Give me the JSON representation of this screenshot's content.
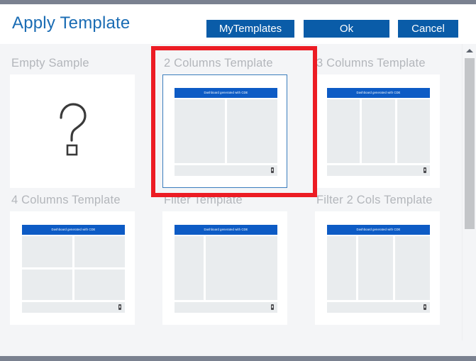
{
  "window": {
    "chrome_color": "#7a8190",
    "background": "#f4f5f7"
  },
  "header": {
    "title": "Apply Template",
    "title_color": "#1a6cb4",
    "button_color": "#0a5ca8",
    "buttons": [
      {
        "id": "mytemplates",
        "label": "MyTemplates"
      },
      {
        "id": "ok",
        "label": "Ok"
      },
      {
        "id": "cancel",
        "label": "Cancel"
      }
    ]
  },
  "highlight": {
    "color": "#ec1c24",
    "target": "2 Columns Template"
  },
  "thumbnail": {
    "titlebar_text": "Dashboard generated with CDE",
    "titlebar_color": "#0d5bc5",
    "panel_color": "#e9ecee"
  },
  "templates": [
    {
      "id": "empty-sample",
      "label": "Empty Sample",
      "layout": "empty",
      "selected": false
    },
    {
      "id": "2-columns",
      "label": "2 Columns Template",
      "layout": "cols-2",
      "selected": true
    },
    {
      "id": "3-columns",
      "label": "3 Columns Template",
      "layout": "cols-3",
      "selected": false
    },
    {
      "id": "4-columns",
      "label": "4 Columns Template",
      "layout": "grid-2x2",
      "selected": false
    },
    {
      "id": "filter",
      "label": "Filter Template",
      "layout": "filter-1",
      "selected": false
    },
    {
      "id": "filter-2-cols",
      "label": "Filter 2 Cols Template",
      "layout": "filter-2",
      "selected": false
    }
  ],
  "scrollbar": {
    "up_arrow": "chevron-up-icon",
    "down_arrow": "chevron-down-icon",
    "thumb_position_percent": 0
  }
}
